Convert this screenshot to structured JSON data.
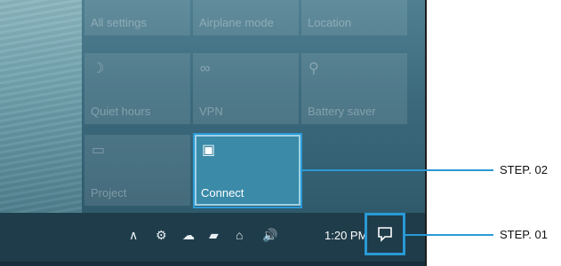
{
  "quick_actions": {
    "row_top": [
      "All settings",
      "Airplane mode",
      "Location"
    ],
    "tiles": [
      {
        "label": "Quiet hours",
        "icon": "moon-icon",
        "glyph": "☽"
      },
      {
        "label": "VPN",
        "icon": "vpn-icon",
        "glyph": "∞"
      },
      {
        "label": "Battery saver",
        "icon": "battery-saver-icon",
        "glyph": "⚲"
      },
      {
        "label": "Project",
        "icon": "project-icon",
        "glyph": "▭"
      },
      {
        "label": "Connect",
        "icon": "connect-icon",
        "glyph": "▣"
      }
    ]
  },
  "taskbar": {
    "tray_icons": [
      {
        "name": "chevron-up-icon",
        "glyph": "∧"
      },
      {
        "name": "shield-icon",
        "glyph": "⚙"
      },
      {
        "name": "cloud-icon",
        "glyph": "☁"
      },
      {
        "name": "battery-icon",
        "glyph": "▰"
      },
      {
        "name": "network-icon",
        "glyph": "⌂"
      },
      {
        "name": "volume-icon",
        "glyph": "🔊"
      }
    ],
    "clock": "1:20 PM"
  },
  "annotations": {
    "step1": "STEP. 01",
    "step2": "STEP. 02"
  },
  "colors": {
    "accent": "#2a9ad6",
    "taskbar": "#1f3c4a",
    "active_tile": "#3a8aa8"
  }
}
